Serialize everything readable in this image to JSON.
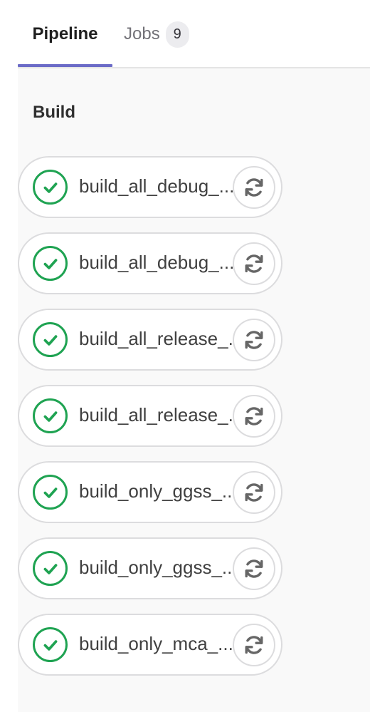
{
  "tabs": {
    "pipeline_label": "Pipeline",
    "jobs_label": "Jobs",
    "jobs_count": "9"
  },
  "stage": {
    "title": "Build"
  },
  "jobs": [
    {
      "name": "build_all_debug_...",
      "status": "success",
      "action": "retry"
    },
    {
      "name": "build_all_debug_...",
      "status": "success",
      "action": "retry"
    },
    {
      "name": "build_all_release_...",
      "status": "success",
      "action": "retry"
    },
    {
      "name": "build_all_release_...",
      "status": "success",
      "action": "retry"
    },
    {
      "name": "build_only_ggss_...",
      "status": "success",
      "action": "retry"
    },
    {
      "name": "build_only_ggss_...",
      "status": "success",
      "action": "retry"
    },
    {
      "name": "build_only_mca_...",
      "status": "success",
      "action": "retry"
    }
  ],
  "colors": {
    "accent": "#6b6bc7",
    "success": "#1fa352",
    "icon_gray": "#666666",
    "panel_bg": "#f9f9f9"
  },
  "icons": {
    "status": "check-circle-icon",
    "action": "retry-icon"
  }
}
